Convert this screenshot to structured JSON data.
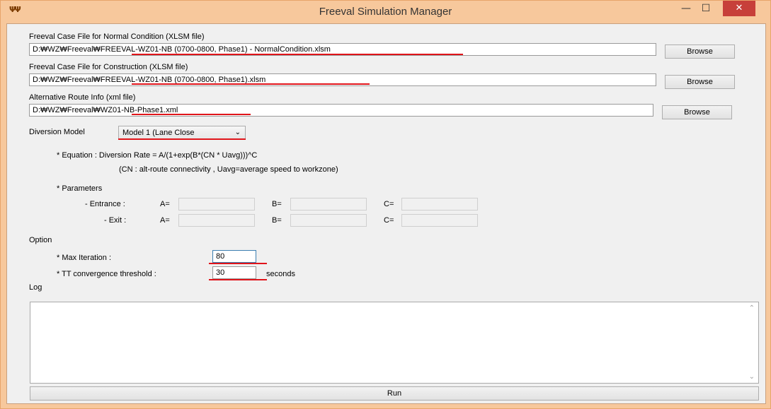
{
  "window": {
    "title": "Freeval Simulation Manager",
    "app_icon": "ΨΨ",
    "minimize": "—",
    "maximize": "☐",
    "close": "✕"
  },
  "normal_case": {
    "label": "Freeval Case File for Normal Condition (XLSM file)",
    "path": "D:₩WZ₩Freeval₩FREEVAL-WZ01-NB (0700-0800, Phase1) - NormalCondition.xlsm",
    "browse": "Browse"
  },
  "construction_case": {
    "label": "Freeval Case File for Construction (XLSM file)",
    "path": "D:₩WZ₩Freeval₩FREEVAL-WZ01-NB (0700-0800, Phase1).xlsm",
    "browse": "Browse"
  },
  "alt_route": {
    "label": "Alternative Route Info (xml file)",
    "path": "D:₩WZ₩Freeval₩WZ01-NB-Phase1.xml",
    "browse": "Browse"
  },
  "diversion": {
    "label": "Diversion Model",
    "selected": "Model 1 (Lane Close",
    "arrow": "⌄"
  },
  "equation": {
    "line1": "* Equation : Diversion Rate = A/(1+exp(B*(CN * Uavg)))^C",
    "line2": "(CN : alt-route connectivity , Uavg=average speed to workzone)"
  },
  "parameters": {
    "header": "* Parameters",
    "entrance_label": "- Entrance :",
    "exit_label": "- Exit :",
    "a_label": "A=",
    "b_label": "B=",
    "c_label": "C=",
    "entrance": {
      "a": "",
      "b": "",
      "c": ""
    },
    "exit": {
      "a": "",
      "b": "",
      "c": ""
    }
  },
  "option": {
    "header": "Option",
    "max_iteration_label": "* Max Iteration :",
    "max_iteration_value": "80",
    "tt_label": "* TT convergence threshold :",
    "tt_value": "30",
    "tt_unit": "seconds"
  },
  "log": {
    "label": "Log",
    "content": ""
  },
  "run_button": "Run",
  "colors": {
    "frame": "#f7c89c",
    "close_button": "#c7403a",
    "highlight_underline": "#e0141a"
  }
}
